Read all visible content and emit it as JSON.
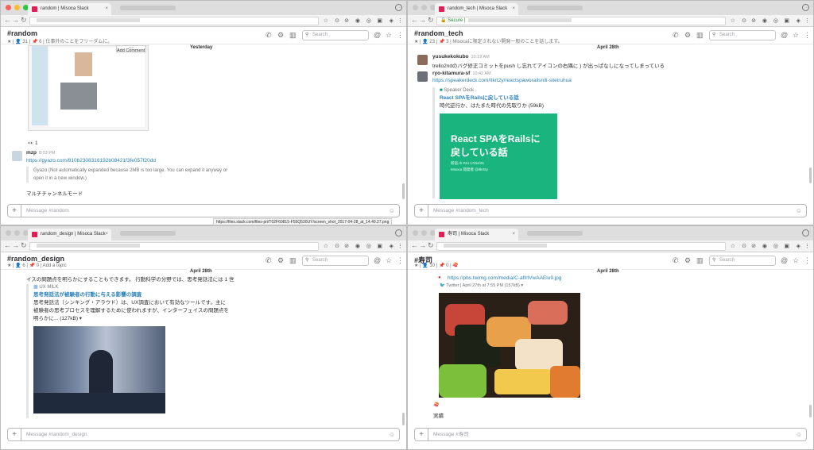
{
  "windows": [
    {
      "tab_title": "random | Misoca Slack",
      "channel": "#random",
      "meta": "★ | 👤 31 | 📌 6 | 仕事外のことをフリーダムに。",
      "search_placeholder": "Search",
      "day_divider": "Yesterday",
      "image_comment": "Add Comment",
      "reactions": "👀 1",
      "message": {
        "user": "mzp",
        "time": "8:03 PM",
        "link": "https://gyazo.com/810b2308316192b08421f3fe057f20dd",
        "attach_note": "Gyazo (Not automatically expanded because 2MB is too large. You can expand it anyway or open it in a new window.)",
        "text": "マルチチャンネルモード"
      },
      "composer_placeholder": "Message #random",
      "status_url": "https://files.slack.com/files-pri/T02F60815-F55Q530UY/screen_shot_2017-04-28_at_14.49.27.png"
    },
    {
      "tab_title": "random_tech | Misoca Slack",
      "url_secure": "Secure",
      "channel": "#random_tech",
      "meta": "★ | 👤 23 | 📌 3 | Misocaに限定されない開発一般のことを話します。",
      "search_placeholder": "Search",
      "day_divider": "April 28th",
      "msg1": {
        "user": "yusukekokubo",
        "time": "10:19 AM",
        "text": "trello2ndのバグ修正コミットをpush し忘れてアイコンの右隅に ) が出っぱなしになってしまっている"
      },
      "msg2": {
        "user": "ryo-kitamura-sf",
        "time": "10:42 AM",
        "link": "https://speakerdeck.com/itkrt2y/reactspaworailsnili-siteiruhua"
      },
      "preview": {
        "site": "Speaker Deck",
        "title": "React SPAをRailsに戻している話",
        "desc": "時代逆行か、はたまた時代の先取りか (59kB)",
        "slide_title": "React SPAをRailsに戻している話",
        "slide_sub1": "新宿.rb #44 17/04/26",
        "slide_sub2": "Misoca 開発者 @itkrt2y"
      },
      "composer_placeholder": "Message #random_tech"
    },
    {
      "tab_title": "random_design | Misoca Slack",
      "channel": "#random_design",
      "meta": "★ | 👤 6 | 📌 0 | Add a topic",
      "search_placeholder": "Search",
      "day_divider": "April 28th",
      "lead": "イスの問題点を明らかにすることもできます。 行動科学の分野では、思考発話法には 1 世",
      "preview": {
        "site": "UX MILK",
        "title": "思考発話法が被験者の行動に与える影響の調査",
        "desc1": "思考発話法（シンキング・アラウド）は、UX調査において有効なツールです。主に",
        "desc2": "被験者の思考プロセスを理解するために使われますが、インターフェイスの問題点を",
        "desc3": "明らかに... (127kB) ▾"
      },
      "composer_placeholder": "Message #random_design"
    },
    {
      "tab_title": "寿司 | Misoca Slack",
      "channel": "#寿司",
      "meta": "★ | 👤 10 | 📌 0 | 🍣",
      "search_placeholder": "Search",
      "day_divider": "April 28th",
      "link": "https://pbs.twimg.com/media/C-afIrtVwAAElu9.jpg",
      "source": "Twitter | April 27th at 7:55 PM (157kB) ▾",
      "reaction": "🍣",
      "text": "実績",
      "composer_placeholder": "Message #寿司"
    }
  ]
}
